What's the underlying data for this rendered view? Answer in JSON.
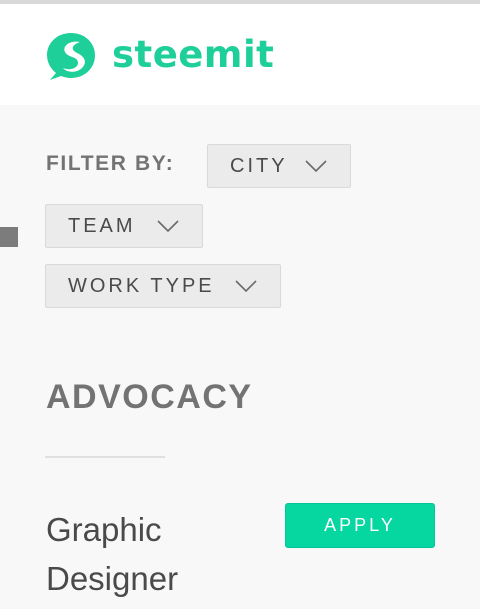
{
  "header": {
    "brand": "steemit",
    "logo_icon": "steemit-logo-icon",
    "brand_color": "#1fcf9a"
  },
  "filters": {
    "label": "FILTER BY:",
    "options": [
      {
        "label": "CITY",
        "icon": "chevron-down-icon"
      },
      {
        "label": "TEAM",
        "icon": "chevron-down-icon"
      },
      {
        "label": "WORK TYPE",
        "icon": "chevron-down-icon"
      }
    ]
  },
  "section": {
    "title": "ADVOCACY"
  },
  "jobs": [
    {
      "title": "Graphic Designer",
      "apply_label": "APPLY"
    }
  ],
  "colors": {
    "accent": "#06d6a0",
    "text_gray": "#737373",
    "chip_bg": "#ebebeb"
  }
}
